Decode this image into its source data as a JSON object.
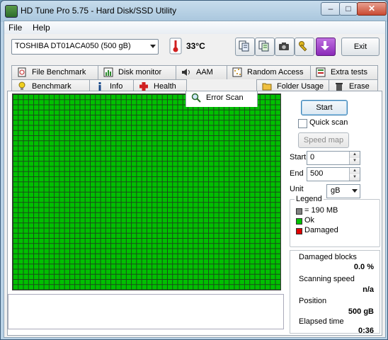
{
  "window": {
    "title": "HD Tune Pro 5.75 - Hard Disk/SSD Utility"
  },
  "menu": {
    "file": "File",
    "help": "Help"
  },
  "toolbar": {
    "drive": "TOSHIBA DT01ACA050 (500 gB)",
    "temperature": "33°C",
    "exit_label": "Exit"
  },
  "tabs_top": [
    "File Benchmark",
    "Disk monitor",
    "AAM",
    "Random Access",
    "Extra tests"
  ],
  "tabs_bottom": [
    "Benchmark",
    "Info",
    "Health",
    "Error Scan",
    "Folder Usage",
    "Erase"
  ],
  "active_tab": "Error Scan",
  "scan": {
    "start_button": "Start",
    "quick_scan_label": "Quick scan",
    "quick_scan_checked": false,
    "speed_map_button": "Speed map",
    "start_label": "Start",
    "start_value": "0",
    "end_label": "End",
    "end_value": "500",
    "unit_label": "Unit",
    "unit_value": "gB"
  },
  "legend": {
    "title": "Legend",
    "items": [
      {
        "label": "= 190 MB",
        "color": "#808080"
      },
      {
        "label": "Ok",
        "color": "#00c000"
      },
      {
        "label": "Damaged",
        "color": "#e00000"
      }
    ]
  },
  "stats": {
    "damaged_label": "Damaged blocks",
    "damaged_value": "0.0 %",
    "speed_label": "Scanning speed",
    "speed_value": "n/a",
    "position_label": "Position",
    "position_value": "500 gB",
    "elapsed_label": "Elapsed time",
    "elapsed_value": "0:36"
  },
  "colors": {
    "ok_block": "#00c000",
    "accent": "#3c7fb1"
  }
}
